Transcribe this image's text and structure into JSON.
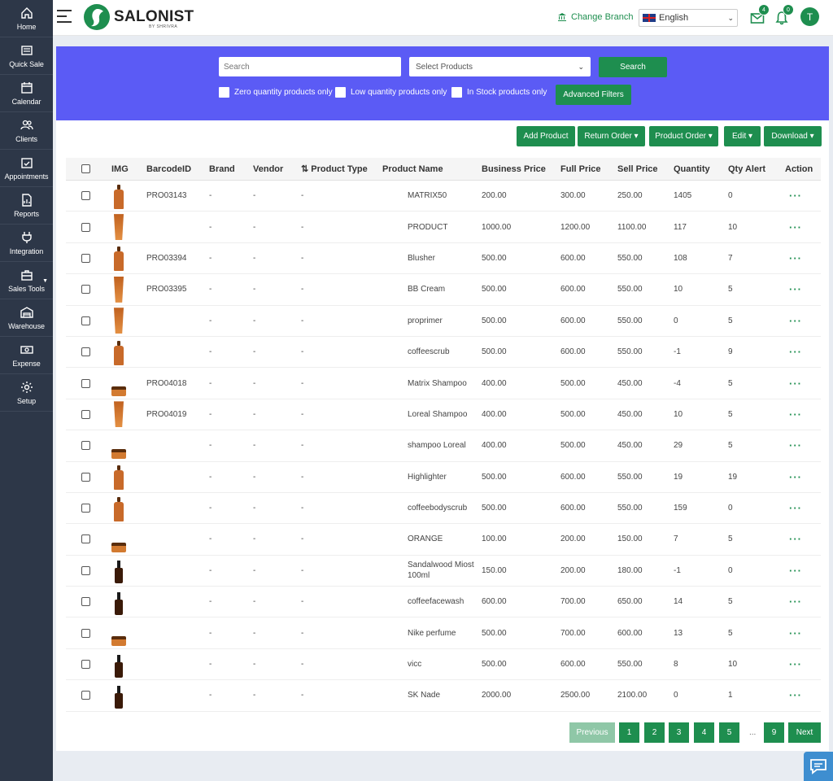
{
  "sidebar": {
    "items": [
      {
        "label": "Home",
        "icon": "home-icon"
      },
      {
        "label": "Quick Sale",
        "icon": "register-icon"
      },
      {
        "label": "Calendar",
        "icon": "calendar-icon"
      },
      {
        "label": "Clients",
        "icon": "users-icon"
      },
      {
        "label": "Appointments",
        "icon": "appointment-icon"
      },
      {
        "label": "Reports",
        "icon": "report-icon"
      },
      {
        "label": "Integration",
        "icon": "plug-icon"
      },
      {
        "label": "Sales Tools",
        "icon": "briefcase-icon"
      },
      {
        "label": "Warehouse",
        "icon": "warehouse-icon"
      },
      {
        "label": "Expense",
        "icon": "money-icon"
      },
      {
        "label": "Setup",
        "icon": "gear-icon"
      }
    ]
  },
  "header": {
    "brand": "SALONIST",
    "brand_sub": "BY SHRIVRA",
    "change_branch": "Change Branch",
    "language": "English",
    "mail_count": "4",
    "notif_count": "0",
    "avatar_letter": "T"
  },
  "filters": {
    "search_placeholder": "Search",
    "select_products": "Select Products",
    "search_button": "Search",
    "zero_qty": "Zero quantity products only",
    "low_qty": "Low quantity products only",
    "in_stock": "In Stock products only",
    "advanced": "Advanced Filters"
  },
  "actions": {
    "add_product": "Add Product",
    "return_order": "Return Order ▾",
    "product_order": "Product Order ▾",
    "edit": "Edit ▾",
    "download": "Download ▾"
  },
  "table": {
    "columns": [
      "IMG",
      "BarcodeID",
      "Brand",
      "Vendor",
      "⇅ Product Type",
      "Product Name",
      "Business Price",
      "Full Price",
      "Sell Price",
      "Quantity",
      "Qty Alert",
      "Action"
    ],
    "rows": [
      {
        "img": "bottle",
        "barcode": "PRO03143",
        "brand": "-",
        "vendor": "-",
        "type": "-",
        "name": "MATRIX50",
        "business": "200.00",
        "full": "300.00",
        "sell": "250.00",
        "qty": "1405",
        "alert": "0"
      },
      {
        "img": "tube",
        "barcode": "",
        "brand": "-",
        "vendor": "-",
        "type": "-",
        "name": "PRODUCT",
        "business": "1000.00",
        "full": "1200.00",
        "sell": "1100.00",
        "qty": "117",
        "alert": "10"
      },
      {
        "img": "bottle",
        "barcode": "PRO03394",
        "brand": "-",
        "vendor": "-",
        "type": "-",
        "name": "Blusher",
        "business": "500.00",
        "full": "600.00",
        "sell": "550.00",
        "qty": "108",
        "alert": "7"
      },
      {
        "img": "tube",
        "barcode": "PRO03395",
        "brand": "-",
        "vendor": "-",
        "type": "-",
        "name": "BB Cream",
        "business": "500.00",
        "full": "600.00",
        "sell": "550.00",
        "qty": "10",
        "alert": "5"
      },
      {
        "img": "tube",
        "barcode": "",
        "brand": "-",
        "vendor": "-",
        "type": "-",
        "name": "proprimer",
        "business": "500.00",
        "full": "600.00",
        "sell": "550.00",
        "qty": "0",
        "alert": "5"
      },
      {
        "img": "bottle",
        "barcode": "",
        "brand": "-",
        "vendor": "-",
        "type": "-",
        "name": "coffeescrub",
        "business": "500.00",
        "full": "600.00",
        "sell": "550.00",
        "qty": "-1",
        "alert": "9"
      },
      {
        "img": "jar",
        "barcode": "PRO04018",
        "brand": "-",
        "vendor": "-",
        "type": "-",
        "name": "Matrix Shampoo",
        "business": "400.00",
        "full": "500.00",
        "sell": "450.00",
        "qty": "-4",
        "alert": "5"
      },
      {
        "img": "tube",
        "barcode": "PRO04019",
        "brand": "-",
        "vendor": "-",
        "type": "-",
        "name": "Loreal Shampoo",
        "business": "400.00",
        "full": "500.00",
        "sell": "450.00",
        "qty": "10",
        "alert": "5"
      },
      {
        "img": "jar",
        "barcode": "",
        "brand": "-",
        "vendor": "-",
        "type": "-",
        "name": "shampoo Loreal",
        "business": "400.00",
        "full": "500.00",
        "sell": "450.00",
        "qty": "29",
        "alert": "5"
      },
      {
        "img": "bottle",
        "barcode": "",
        "brand": "-",
        "vendor": "-",
        "type": "-",
        "name": "Highlighter",
        "business": "500.00",
        "full": "600.00",
        "sell": "550.00",
        "qty": "19",
        "alert": "19"
      },
      {
        "img": "bottle",
        "barcode": "",
        "brand": "-",
        "vendor": "-",
        "type": "-",
        "name": "coffeebodyscrub",
        "business": "500.00",
        "full": "600.00",
        "sell": "550.00",
        "qty": "159",
        "alert": "0"
      },
      {
        "img": "jar",
        "barcode": "",
        "brand": "-",
        "vendor": "-",
        "type": "-",
        "name": "ORANGE",
        "business": "100.00",
        "full": "200.00",
        "sell": "150.00",
        "qty": "7",
        "alert": "5"
      },
      {
        "img": "dropper",
        "barcode": "",
        "brand": "-",
        "vendor": "-",
        "type": "-",
        "name": "Sandalwood Miost 100ml",
        "business": "150.00",
        "full": "200.00",
        "sell": "180.00",
        "qty": "-1",
        "alert": "0"
      },
      {
        "img": "dropper",
        "barcode": "",
        "brand": "-",
        "vendor": "-",
        "type": "-",
        "name": "coffeefacewash",
        "business": "600.00",
        "full": "700.00",
        "sell": "650.00",
        "qty": "14",
        "alert": "5"
      },
      {
        "img": "jar",
        "barcode": "",
        "brand": "-",
        "vendor": "-",
        "type": "-",
        "name": "Nike perfume",
        "business": "500.00",
        "full": "700.00",
        "sell": "600.00",
        "qty": "13",
        "alert": "5"
      },
      {
        "img": "dropper",
        "barcode": "",
        "brand": "-",
        "vendor": "-",
        "type": "-",
        "name": "vicc",
        "business": "500.00",
        "full": "600.00",
        "sell": "550.00",
        "qty": "8",
        "alert": "10"
      },
      {
        "img": "dropper",
        "barcode": "",
        "brand": "-",
        "vendor": "-",
        "type": "-",
        "name": "SK Nade",
        "business": "2000.00",
        "full": "2500.00",
        "sell": "2100.00",
        "qty": "0",
        "alert": "1"
      }
    ],
    "action_label": "···"
  },
  "pagination": {
    "previous": "Previous",
    "pages": [
      "1",
      "2",
      "3",
      "4",
      "5"
    ],
    "ellipsis": "...",
    "last": "9",
    "next": "Next"
  },
  "colors": {
    "sidebar": "#2d3748",
    "accent": "#1e8e4f",
    "filter_panel": "#5b5bf5"
  }
}
